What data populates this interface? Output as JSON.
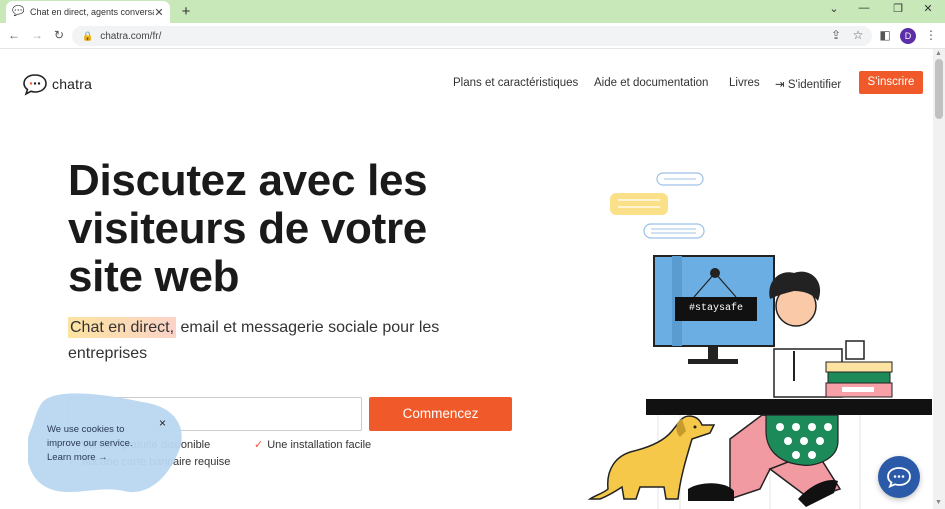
{
  "browser": {
    "tab_title": "Chat en direct, agents conversati",
    "tab_close": "✕",
    "new_tab": "+",
    "url": "chatra.com/fr/",
    "profile_initial": "D"
  },
  "header": {
    "logo_text": "chatra",
    "nav": [
      "Plans et caractéristiques",
      "Aide et documentation",
      "Livres",
      "S'identifier"
    ],
    "signup": "S'inscrire"
  },
  "hero": {
    "title": "Discutez avec les visiteurs de votre site web",
    "subtitle_highlight": "Chat en direct,",
    "subtitle_rest": " email et messagerie sociale pour les entreprises",
    "email_placeholder": "",
    "cta": "Commencez",
    "features": [
      "Version gratuite disponible",
      "Une installation facile",
      "Aucune carte bancaire requise"
    ],
    "sign_text": "#staysafe"
  },
  "cookie": {
    "line1": "We use cookies to",
    "line2": "improve our service.",
    "learn_more": "Learn more →",
    "close": "×"
  },
  "colors": {
    "accent": "#f05a2a",
    "chrome_tab_bar": "#c9e8b9",
    "cookie_blob": "#b9d7f0",
    "fab": "#2a5aa8"
  },
  "icons": [
    "chat-bubble-icon",
    "back-arrow-icon",
    "forward-arrow-icon",
    "reload-icon",
    "lock-icon",
    "share-icon",
    "star-icon",
    "sidebar-icon",
    "menu-dots-icon",
    "login-icon",
    "check-icon",
    "chat-fab-icon"
  ]
}
